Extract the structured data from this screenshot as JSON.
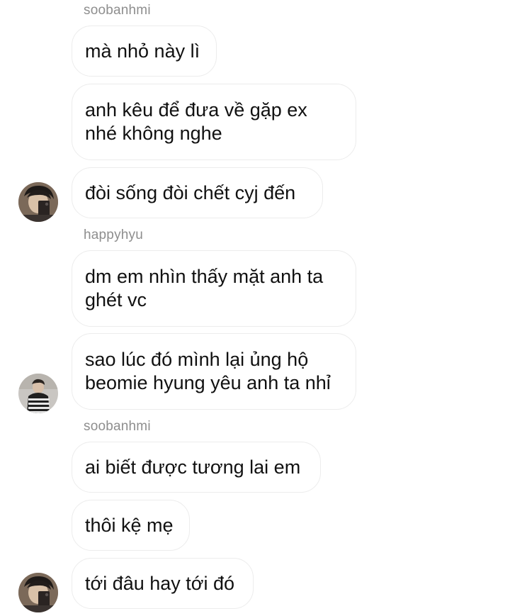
{
  "conversation": {
    "groups": [
      {
        "sender": "soobanhmi",
        "messages": [
          "mà nhỏ này lì",
          "anh kêu để đưa về gặp ex\nnhé không nghe",
          "đòi sống đòi chết cyj đến"
        ]
      },
      {
        "sender": "happyhyu",
        "messages": [
          "dm em nhìn thấy mặt anh ta\nghét vc",
          "sao lúc đó mình lại ủng hộ\nbeomie hyung yêu anh ta nhỉ"
        ]
      },
      {
        "sender": "soobanhmi",
        "messages": [
          "ai biết được tương lai em",
          "thôi kệ mẹ",
          "tới đâu hay tới đó"
        ]
      }
    ]
  }
}
